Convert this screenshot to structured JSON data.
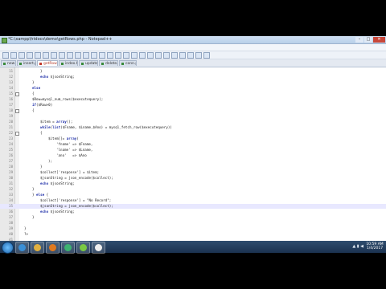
{
  "window": {
    "title": "*C:\\xampp\\htdocs\\demo\\getRows.php - Notepad++",
    "buttons": {
      "minimize": "–",
      "maximize": "□",
      "close": "✕"
    }
  },
  "menu": [
    "File",
    "Edit",
    "Search",
    "View",
    "Encoding",
    "Language",
    "Settings",
    "Macro",
    "Run",
    "Plugins",
    "Window",
    "?"
  ],
  "tabs": [
    {
      "label": "new 1",
      "active": false
    },
    {
      "label": "insert.php",
      "active": false
    },
    {
      "label": "getRows.php",
      "active": true
    },
    {
      "label": "index.html",
      "active": false
    },
    {
      "label": "update.php",
      "active": false
    },
    {
      "label": "delete.php",
      "active": false
    },
    {
      "label": "conn.php",
      "active": false
    }
  ],
  "editor": {
    "current_line": 29,
    "lines": [
      {
        "n": "11",
        "indent": 2,
        "text": "}"
      },
      {
        "n": "12",
        "indent": 2,
        "text": "echo $jsonString;",
        "kw": "echo"
      },
      {
        "n": "13",
        "indent": 1,
        "text": "}"
      },
      {
        "n": "14",
        "indent": 1,
        "text": "else"
      },
      {
        "n": "15",
        "indent": 1,
        "text": "{",
        "fold": true
      },
      {
        "n": "16",
        "indent": 1,
        "text": "$Row=mysql_num_rows($executequery);"
      },
      {
        "n": "17",
        "indent": 1,
        "text": "if($Row>0)"
      },
      {
        "n": "18",
        "indent": 1,
        "text": "{",
        "fold": true
      },
      {
        "n": "19",
        "indent": 2,
        "text": ""
      },
      {
        "n": "20",
        "indent": 2,
        "text": "$item = array();"
      },
      {
        "n": "21",
        "indent": 2,
        "text": "while(list($Fname, $Lname,$Ano) = mysql_fetch_row($executequery))"
      },
      {
        "n": "22",
        "indent": 2,
        "text": "{",
        "fold": true
      },
      {
        "n": "23",
        "indent": 3,
        "text": "$item[]= array("
      },
      {
        "n": "24",
        "indent": 4,
        "text": "'fname' => $Fname,"
      },
      {
        "n": "25",
        "indent": 4,
        "text": "'lname' => $Lname,"
      },
      {
        "n": "26",
        "indent": 4,
        "text": "'ano'   => $Ano"
      },
      {
        "n": "27",
        "indent": 3,
        "text": ");"
      },
      {
        "n": "28",
        "indent": 2,
        "text": "}"
      },
      {
        "n": "29",
        "indent": 2,
        "text": "$collect['response'] = $item;"
      },
      {
        "n": "30",
        "indent": 2,
        "text": "$jsonString = json_encode($collect);"
      },
      {
        "n": "31",
        "indent": 2,
        "text": "echo $jsonString;"
      },
      {
        "n": "32",
        "indent": 1,
        "text": "}"
      },
      {
        "n": "33",
        "indent": 1,
        "text": "} else {"
      },
      {
        "n": "34",
        "indent": 2,
        "text": "$collect['response'] = \"No Record\";"
      },
      {
        "n": "35",
        "indent": 2,
        "text": "$jsonString = json_encode($collect);"
      },
      {
        "n": "36",
        "indent": 2,
        "text": "echo $jsonString;"
      },
      {
        "n": "37",
        "indent": 1,
        "text": "}"
      },
      {
        "n": "38",
        "indent": 1,
        "text": ""
      },
      {
        "n": "39",
        "indent": 0,
        "text": "}"
      },
      {
        "n": "40",
        "indent": 0,
        "text": "?>"
      },
      {
        "n": "41",
        "indent": 0,
        "text": ""
      }
    ]
  },
  "status": {
    "filetype": "PHP Hypertext Preprocessor file",
    "length": "length : 827    lines : 40",
    "position": "Ln : 35    Col : 40    Sel : 0 | 0",
    "eol": "Dos\\Windows",
    "encoding": "UTF-8 w/o BOM",
    "mode": "INS"
  },
  "taskbar": {
    "apps": [
      "ie-icon",
      "folder-icon",
      "media-player-icon",
      "chrome-icon",
      "notepadpp-icon",
      "app-icon"
    ],
    "clock_time": "10:59 AM",
    "clock_date": "1/4/2017"
  },
  "colors": {
    "keyword": "#1e2ea8",
    "current_line": "#e8e8ff",
    "active_tab_text": "#b23a2a"
  }
}
